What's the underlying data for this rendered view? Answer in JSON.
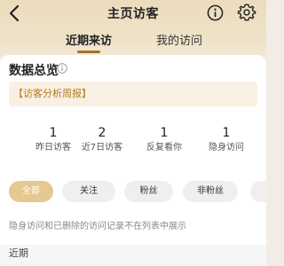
{
  "nav": {
    "title": "主页访客",
    "back_icon": "chevron-left-icon",
    "info_icon": "info-circle-icon",
    "settings_icon": "gear-icon"
  },
  "tabs": [
    {
      "label": "近期来访",
      "active": true
    },
    {
      "label": "我的访问",
      "active": false
    }
  ],
  "overview": {
    "title": "数据总览",
    "report_link": "【访客分析周报】",
    "stats": [
      {
        "value": "1",
        "label": "昨日访客"
      },
      {
        "value": "2",
        "label": "近7日访客"
      },
      {
        "value": "1",
        "label": "反复看你"
      },
      {
        "value": "1",
        "label": "隐身访问"
      }
    ]
  },
  "filters": [
    {
      "label": "全部",
      "active": true
    },
    {
      "label": "关注",
      "active": false
    },
    {
      "label": "粉丝",
      "active": false
    },
    {
      "label": "非粉丝",
      "active": false
    }
  ],
  "notice": "隐身访问和已删除的访问记录不在列表中展示",
  "section_label": "近期",
  "colors": {
    "accent": "#a1722c",
    "report_text": "#b67a1f",
    "active_chip": "#e6c891",
    "header_gold": "#ecdcbd"
  }
}
